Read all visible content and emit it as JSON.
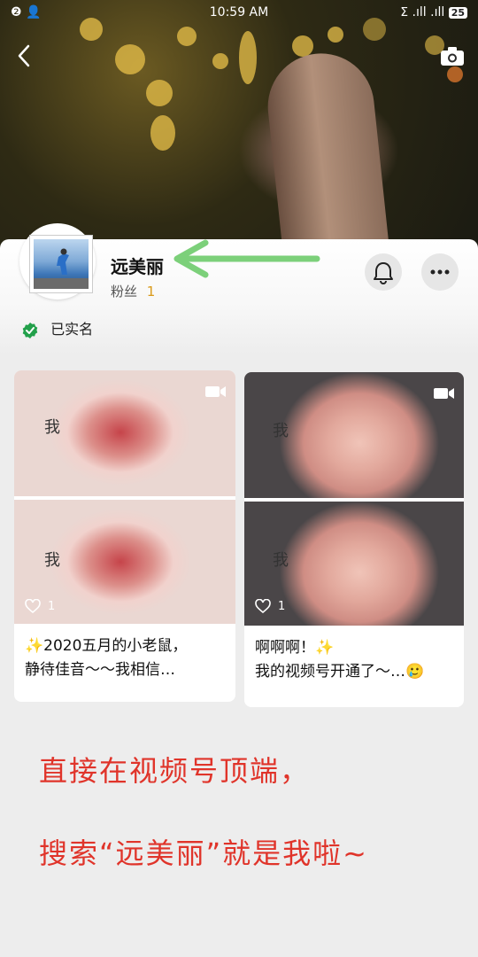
{
  "status_bar": {
    "left": "❷ 👤",
    "time": "10:59 AM",
    "right": "ⵉ .ıll .ıll",
    "battery": "25"
  },
  "profile": {
    "name": "远美丽",
    "fans_label": "粉丝",
    "fans_count": "1",
    "verified_label": "已实名"
  },
  "posts": [
    {
      "thumb_text": "我",
      "likes": "1",
      "caption_line1": "✨2020五月的小老鼠，",
      "caption_line2": "静待佳音～～我相信…"
    },
    {
      "thumb_text": "我",
      "likes": "1",
      "caption_line1": "啊啊啊！✨",
      "caption_line2": "我的视频号开通了～…🥲"
    }
  ],
  "annotation": {
    "line1": "直接在视频号顶端，",
    "line2": "搜索“远美丽”就是我啦~"
  },
  "colors": {
    "arrow": "#7cd07a",
    "annotation_text": "#e0342a",
    "fans_count": "#d99a1a",
    "verified": "#22a04a"
  }
}
